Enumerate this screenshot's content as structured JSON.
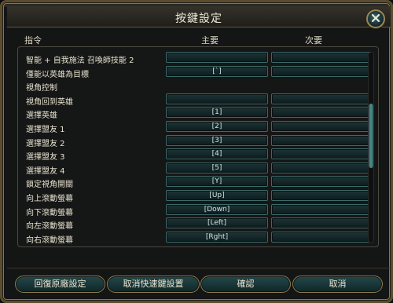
{
  "window": {
    "title": "按鍵設定"
  },
  "header": {
    "command": "指令",
    "primary": "主要",
    "secondary": "次要"
  },
  "rows": [
    {
      "label": "智能 + 自我施法 召喚師技能 2",
      "primary": "",
      "secondary": ""
    },
    {
      "label": "僅能以英雄為目標",
      "primary": "[`]",
      "secondary": ""
    },
    {
      "label": "視角控制",
      "section": true
    },
    {
      "label": "視角回到英雄",
      "primary": "",
      "secondary": ""
    },
    {
      "label": "選擇英雄",
      "primary": "[1]",
      "secondary": ""
    },
    {
      "label": "選擇盟友 1",
      "primary": "[2]",
      "secondary": ""
    },
    {
      "label": "選擇盟友 2",
      "primary": "[3]",
      "secondary": ""
    },
    {
      "label": "選擇盟友 3",
      "primary": "[4]",
      "secondary": ""
    },
    {
      "label": "選擇盟友 4",
      "primary": "[5]",
      "secondary": ""
    },
    {
      "label": "鎖定視角開關",
      "primary": "[Y]",
      "secondary": ""
    },
    {
      "label": "向上滾動螢幕",
      "primary": "[Up]",
      "secondary": ""
    },
    {
      "label": "向下滾動螢幕",
      "primary": "[Down]",
      "secondary": ""
    },
    {
      "label": "向左滾動螢幕",
      "primary": "[Left]",
      "secondary": ""
    },
    {
      "label": "向右滾動螢幕",
      "primary": "[Rght]",
      "secondary": ""
    }
  ],
  "buttons": {
    "reset": "回復原廠設定",
    "cancel_hotkeys": "取消快速鍵設置",
    "confirm": "確認",
    "cancel": "取消"
  },
  "colors": {
    "accent_gold": "#8f7b4d",
    "button_teal": "#24484a",
    "key_teal": "#3d6a6a"
  },
  "icons": {
    "close": "close-icon"
  }
}
